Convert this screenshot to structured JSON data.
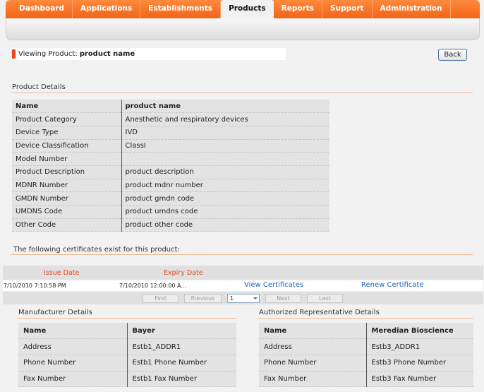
{
  "nav": {
    "tabs": [
      "Dashboard",
      "Applications",
      "Establishments",
      "Products",
      "Reports",
      "Support",
      "Administration"
    ],
    "active": "Products"
  },
  "viewing": {
    "label": "Viewing Product:",
    "name": "product name"
  },
  "back_label": "Back",
  "product_details": {
    "title": "Product Details",
    "rows": [
      {
        "key": "Name",
        "value": "product name"
      },
      {
        "key": "Product Category",
        "value": "Anesthetic and respiratory devices"
      },
      {
        "key": "Device Type",
        "value": "IVD"
      },
      {
        "key": "Device Classification",
        "value": "ClassI"
      },
      {
        "key": "Model Number",
        "value": ""
      },
      {
        "key": "Product Description",
        "value": "product description"
      },
      {
        "key": "MDNR Number",
        "value": "product mdnr number"
      },
      {
        "key": "GMDN Number",
        "value": "product gmdn code"
      },
      {
        "key": "UMDNS Code",
        "value": "product umdns code"
      },
      {
        "key": "Other Code",
        "value": "product other code"
      }
    ]
  },
  "certificates": {
    "title": "The following certificates exist for this product:",
    "headers": {
      "issue": "Issue Date",
      "expiry": "Expiry Date"
    },
    "rows": [
      {
        "issue": "7/10/2010 7:10:58 PM",
        "expiry": "7/10/2010 12:00:00 A...",
        "view": "View Certificates",
        "renew": "Renew Certificate"
      }
    ],
    "pager": {
      "first": "First",
      "previous": "Previous",
      "page": "1",
      "next": "Next",
      "last": "Last"
    }
  },
  "manufacturer": {
    "title": "Manufacturer Details",
    "rows": [
      {
        "key": "Name",
        "value": "Bayer"
      },
      {
        "key": "Address",
        "value": "Estb1_ADDR1"
      },
      {
        "key": "Phone Number",
        "value": "Estb1 Phone Number"
      },
      {
        "key": "Fax Number",
        "value": "Estb1 Fax Number"
      }
    ]
  },
  "representative": {
    "title": "Authorized Representative Details",
    "rows": [
      {
        "key": "Name",
        "value": "Meredian Bioscience"
      },
      {
        "key": "Address",
        "value": "Estb3_ADDR1"
      },
      {
        "key": "Phone Number",
        "value": "Estb3 Phone Number"
      },
      {
        "key": "Fax Number",
        "value": "Estb3 Fax Number"
      }
    ]
  }
}
